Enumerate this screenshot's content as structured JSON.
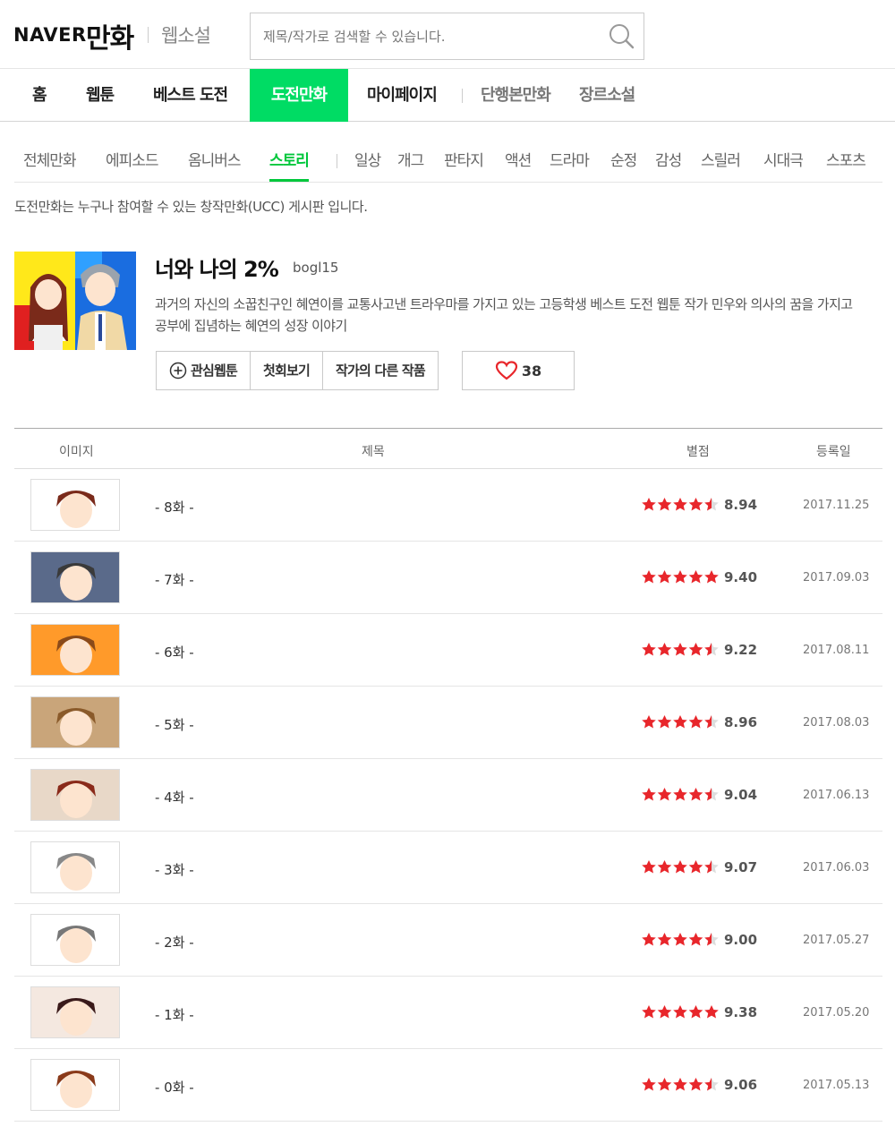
{
  "header": {
    "logo_naver": "NAVER",
    "logo_comic": "만화",
    "logo_novel": "웹소설",
    "search_placeholder": "제목/작가로 검색할 수 있습니다."
  },
  "gnb": {
    "items": [
      "홈",
      "웹툰",
      "베스트 도전",
      "도전만화",
      "마이페이지",
      "단행본만화",
      "장르소설"
    ],
    "active": "도전만화"
  },
  "categories": {
    "items": [
      "전체만화",
      "에피소드",
      "옴니버스",
      "스토리",
      "일상",
      "개그",
      "판타지",
      "액션",
      "드라마",
      "순정",
      "감성",
      "스릴러",
      "시대극",
      "스포츠"
    ],
    "active": "스토리"
  },
  "intro": "도전만화는 누구나 참여할 수 있는 창작만화(UCC) 게시판 입니다.",
  "comic": {
    "title": "너와 나의 2%",
    "author": "bogl15",
    "description": "과거의 자신의 소꿉친구인 혜연이를 교통사고낸 트라우마를 가지고 있는 고등학생 베스트 도전 웹툰 작가 민우와 의사의 꿈을 가지고 공부에 집념하는 혜연의 성장 이야기",
    "buttons": {
      "favorite": "관심웹툰",
      "first": "첫회보기",
      "other": "작가의 다른 작품"
    },
    "likes": "38"
  },
  "table": {
    "headers": {
      "image": "이미지",
      "title": "제목",
      "rating": "별점",
      "date": "등록일"
    },
    "rows": [
      {
        "title": "- 8화 -",
        "rating": "8.94",
        "stars": 4.5,
        "date": "2017.11.25"
      },
      {
        "title": "- 7화 -",
        "rating": "9.40",
        "stars": 5,
        "date": "2017.09.03"
      },
      {
        "title": "- 6화 -",
        "rating": "9.22",
        "stars": 4.5,
        "date": "2017.08.11"
      },
      {
        "title": "- 5화 -",
        "rating": "8.96",
        "stars": 4.5,
        "date": "2017.08.03"
      },
      {
        "title": "- 4화 -",
        "rating": "9.04",
        "stars": 4.5,
        "date": "2017.06.13"
      },
      {
        "title": "- 3화 -",
        "rating": "9.07",
        "stars": 4.5,
        "date": "2017.06.03"
      },
      {
        "title": "- 2화 -",
        "rating": "9.00",
        "stars": 4.5,
        "date": "2017.05.27"
      },
      {
        "title": "- 1화 -",
        "rating": "9.38",
        "stars": 5,
        "date": "2017.05.20"
      },
      {
        "title": "- 0화 -",
        "rating": "9.06",
        "stars": 4.5,
        "date": "2017.05.13"
      }
    ]
  },
  "colors": {
    "accent": "#00dc64",
    "accent_text": "#00c73c",
    "star": "#e8262b"
  }
}
